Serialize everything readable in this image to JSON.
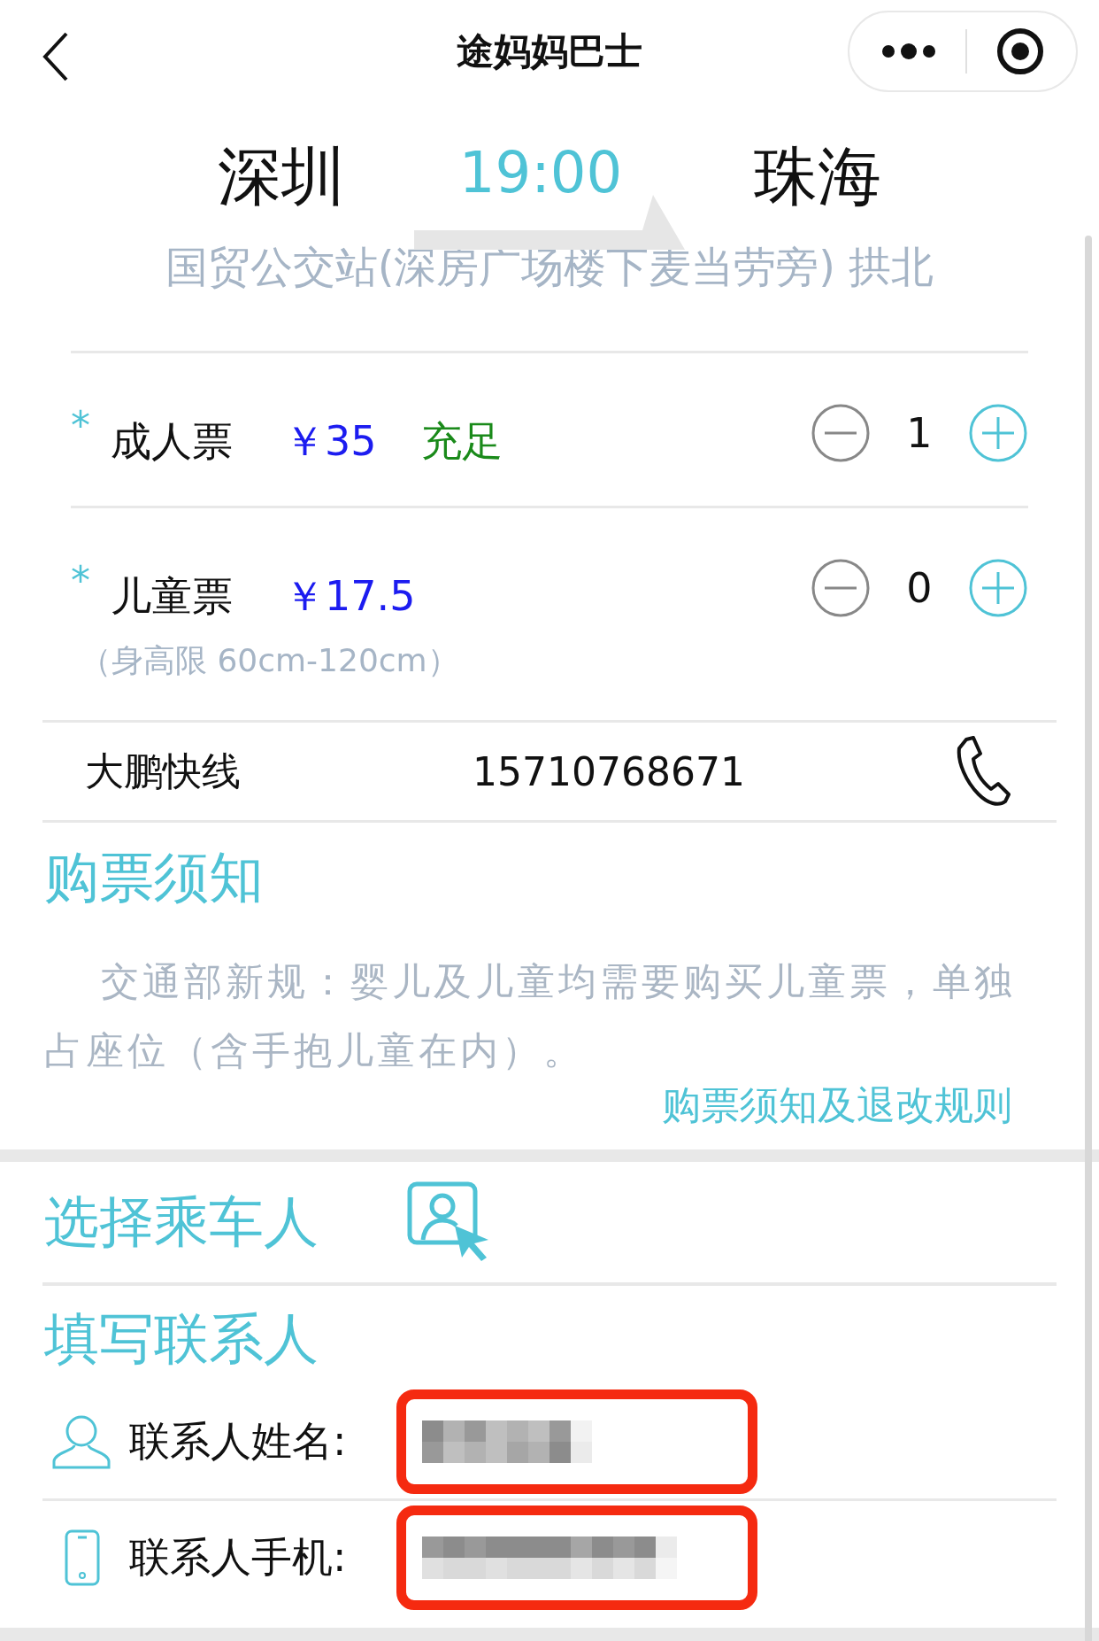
{
  "nav": {
    "title": "途妈妈巴士"
  },
  "route": {
    "from": "深圳",
    "time": "19:00",
    "to": "珠海",
    "stations": "国贸公交站(深房广场楼下麦当劳旁) 拱北"
  },
  "tickets": [
    {
      "required_mark": "*",
      "label": "成人票",
      "price": "￥35",
      "availability": "充足",
      "count": "1"
    },
    {
      "required_mark": "*",
      "label": "儿童票",
      "price": "￥17.5",
      "count": "0",
      "note": "（身高限 60cm-120cm）"
    }
  ],
  "operator": {
    "name": "大鹏快线",
    "phone": "15710768671"
  },
  "notice": {
    "heading": "购票须知",
    "text": "交通部新规：婴儿及儿童均需要购买儿童票，单独占座位（含手抱儿童在内）。",
    "link": "购票须知及退改规则"
  },
  "passenger": {
    "heading": "选择乘车人"
  },
  "contact": {
    "heading": "填写联系人",
    "fields": [
      {
        "kind": "name",
        "label": "联系人姓名:",
        "highlighted": true
      },
      {
        "kind": "phone",
        "label": "联系人手机:",
        "highlighted": true
      }
    ]
  }
}
